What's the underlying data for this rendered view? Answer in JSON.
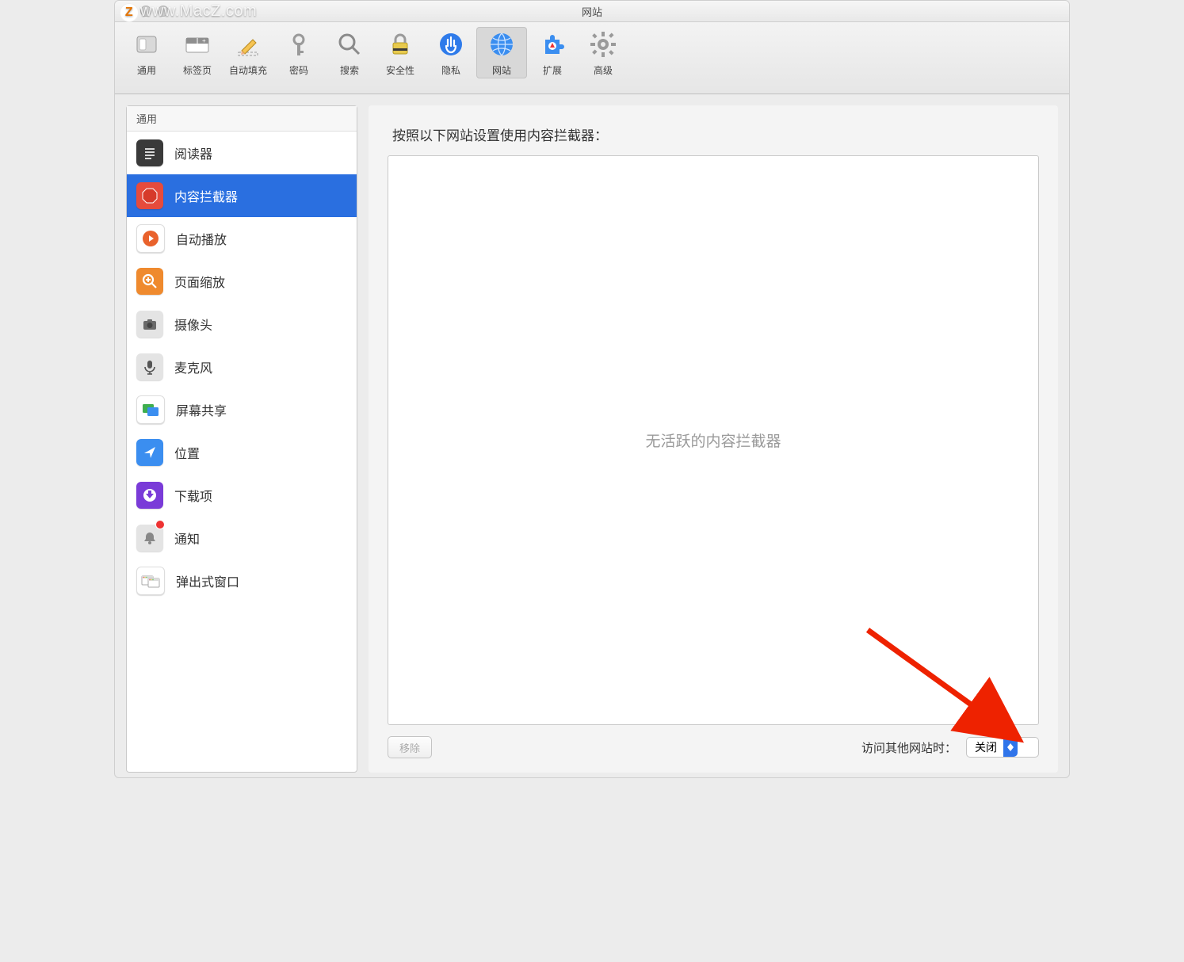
{
  "watermark": "www.MacZ.com",
  "window": {
    "title": "网站"
  },
  "toolbar": {
    "items": [
      {
        "id": "general",
        "label": "通用"
      },
      {
        "id": "tabs",
        "label": "标签页"
      },
      {
        "id": "autofill",
        "label": "自动填充"
      },
      {
        "id": "passwords",
        "label": "密码"
      },
      {
        "id": "search",
        "label": "搜索"
      },
      {
        "id": "security",
        "label": "安全性"
      },
      {
        "id": "privacy",
        "label": "隐私"
      },
      {
        "id": "websites",
        "label": "网站",
        "selected": true
      },
      {
        "id": "extensions",
        "label": "扩展"
      },
      {
        "id": "advanced",
        "label": "高级"
      }
    ]
  },
  "sidebar": {
    "section_title": "通用",
    "items": [
      {
        "id": "reader",
        "label": "阅读器"
      },
      {
        "id": "content-blockers",
        "label": "内容拦截器",
        "selected": true
      },
      {
        "id": "autoplay",
        "label": "自动播放"
      },
      {
        "id": "zoom",
        "label": "页面缩放"
      },
      {
        "id": "camera",
        "label": "摄像头"
      },
      {
        "id": "microphone",
        "label": "麦克风"
      },
      {
        "id": "screenshare",
        "label": "屏幕共享"
      },
      {
        "id": "location",
        "label": "位置"
      },
      {
        "id": "downloads",
        "label": "下载项"
      },
      {
        "id": "notifications",
        "label": "通知",
        "badge": true
      },
      {
        "id": "popups",
        "label": "弹出式窗口"
      }
    ]
  },
  "main": {
    "heading": "按照以下网站设置使用内容拦截器：",
    "empty_text": "无活跃的内容拦截器",
    "remove_label": "移除",
    "other_sites_label": "访问其他网站时：",
    "dropdown_value": "关闭"
  },
  "help_label": "?"
}
